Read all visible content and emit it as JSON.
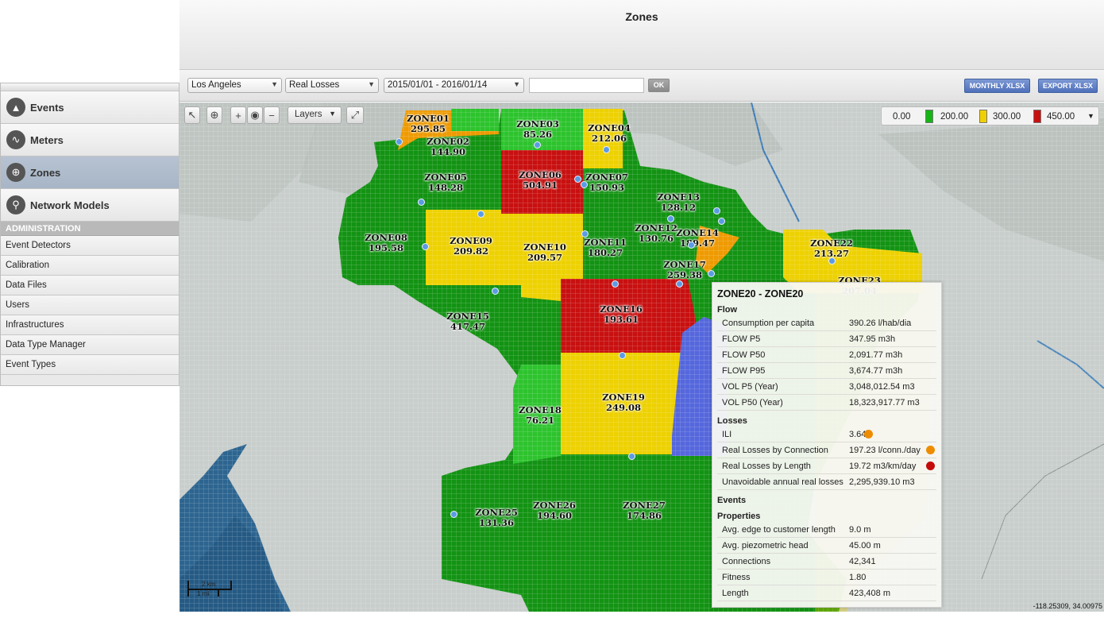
{
  "page_title": "Zones",
  "sidebar": {
    "items": [
      {
        "label": "Events"
      },
      {
        "label": "Meters"
      },
      {
        "label": "Zones"
      },
      {
        "label": "Network Models"
      }
    ],
    "admin_header": "ADMINISTRATION",
    "admin_items": [
      "Event Detectors",
      "Calibration",
      "Data Files",
      "Users",
      "Infrastructures",
      "Data Type Manager",
      "Event Types"
    ]
  },
  "toolbar": {
    "city": "Los Angeles",
    "metric": "Real Losses",
    "date_range": "2015/01/01 - 2016/01/14",
    "search_value": "",
    "ok_label": "OK",
    "monthly_label": "MONTHLY XLSX",
    "export_label": "EXPORT XLSX"
  },
  "map": {
    "layers_label": "Layers",
    "legend": {
      "t0": "0.00",
      "t1": "200.00",
      "t2": "300.00",
      "t3": "450.00",
      "c1": "#16b516",
      "c2": "#f0d000",
      "c3": "#c81010"
    },
    "zone_labels": [
      {
        "name": "ZONE01",
        "value": "295.85"
      },
      {
        "name": "ZONE02",
        "value": "144.90"
      },
      {
        "name": "ZONE03",
        "value": "85.26"
      },
      {
        "name": "ZONE04",
        "value": "212.06"
      },
      {
        "name": "ZONE05",
        "value": "148.28"
      },
      {
        "name": "ZONE06",
        "value": "504.91"
      },
      {
        "name": "ZONE07",
        "value": "150.93"
      },
      {
        "name": "ZONE08",
        "value": "195.58"
      },
      {
        "name": "ZONE09",
        "value": "209.82"
      },
      {
        "name": "ZONE10",
        "value": "209.57"
      },
      {
        "name": "ZONE11",
        "value": "180.27"
      },
      {
        "name": "ZONE12",
        "value": "130.76"
      },
      {
        "name": "ZONE13",
        "value": "128.12"
      },
      {
        "name": "ZONE14",
        "value": "189.47"
      },
      {
        "name": "ZONE15",
        "value": "417.47"
      },
      {
        "name": "ZONE16",
        "value": "193.61"
      },
      {
        "name": "ZONE17",
        "value": "259.38"
      },
      {
        "name": "ZONE18",
        "value": "76.21"
      },
      {
        "name": "ZONE19",
        "value": "249.08"
      },
      {
        "name": "ZONE22",
        "value": "213.27"
      },
      {
        "name": "ZONE23",
        "value": "207.04"
      },
      {
        "name": "ZONE25",
        "value": "131.36"
      },
      {
        "name": "ZONE26",
        "value": "194.60"
      },
      {
        "name": "ZONE27",
        "value": "174.86"
      }
    ],
    "scale_km": "2 km",
    "scale_mi": "1 mi",
    "coords": "-118.25309, 34.00975"
  },
  "popup": {
    "title": "ZONE20 - ZONE20",
    "flow_header": "Flow",
    "flow": [
      {
        "k": "Consumption per capita",
        "v": "390.26 l/hab/dia"
      },
      {
        "k": "FLOW P5",
        "v": "347.95 m3h"
      },
      {
        "k": "FLOW P50",
        "v": "2,091.77 m3h"
      },
      {
        "k": "FLOW P95",
        "v": "3,674.77 m3h"
      },
      {
        "k": "VOL P5 (Year)",
        "v": "3,048,012.54 m3"
      },
      {
        "k": "VOL P50 (Year)",
        "v": "18,323,917.77 m3"
      }
    ],
    "losses_header": "Losses",
    "losses": [
      {
        "k": "ILI",
        "v": "3.64",
        "color": "#ee8c00"
      },
      {
        "k": "Real Losses by Connection",
        "v": "197.23 l/conn./day",
        "color": "#ee8c00"
      },
      {
        "k": "Real Losses by Length",
        "v": "19.72 m3/km/day",
        "color": "#c40a0a"
      },
      {
        "k": "Unavoidable annual real losses",
        "v": "2,295,939.10 m3"
      }
    ],
    "events_header": "Events",
    "props_header": "Properties",
    "props": [
      {
        "k": "Avg. edge to customer length",
        "v": "9.0 m"
      },
      {
        "k": "Avg. piezometric head",
        "v": "45.00 m"
      },
      {
        "k": "Connections",
        "v": "42,341"
      },
      {
        "k": "Fitness",
        "v": "1.80"
      },
      {
        "k": "Length",
        "v": "423,408 m"
      }
    ]
  }
}
